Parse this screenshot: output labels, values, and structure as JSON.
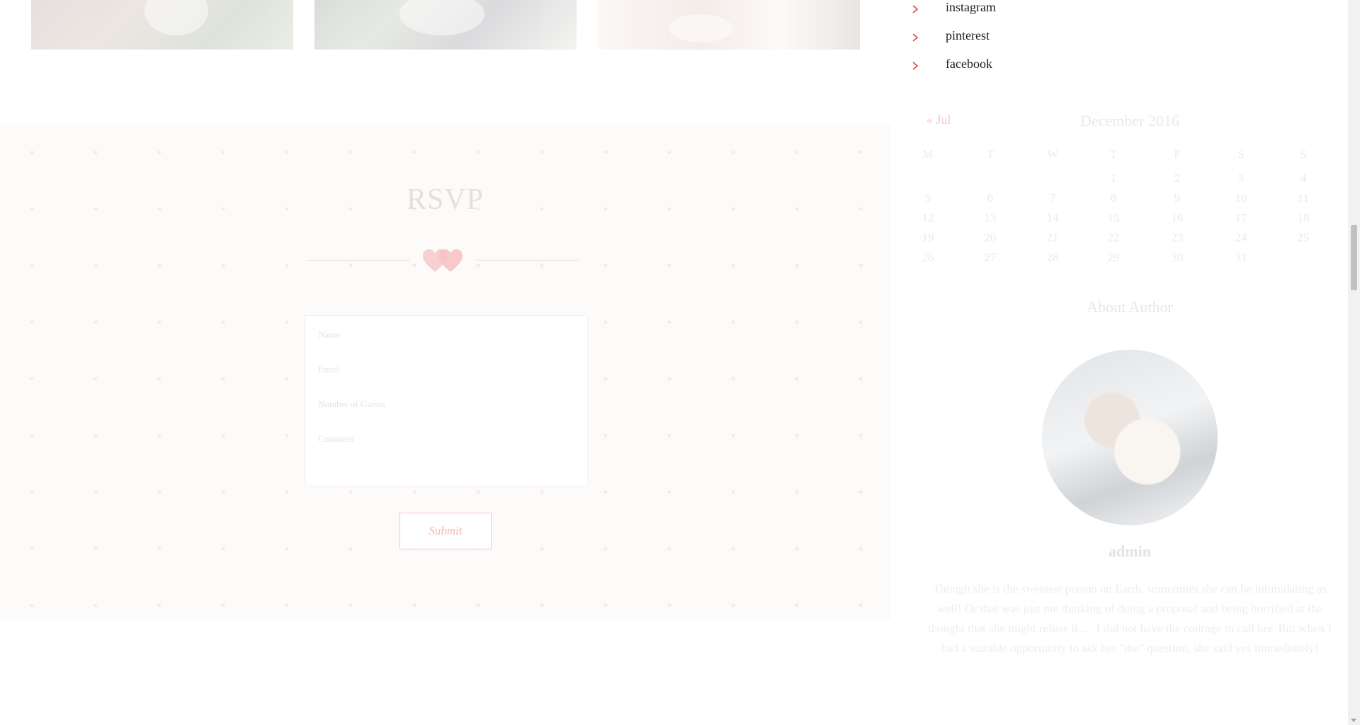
{
  "sidebar": {
    "social_links": [
      {
        "label": "instagram",
        "icon": "chevron-right-icon"
      },
      {
        "label": "pinterest",
        "icon": "chevron-right-icon"
      },
      {
        "label": "facebook",
        "icon": "chevron-right-icon"
      }
    ],
    "calendar": {
      "caption": "December 2016",
      "prev_link": "« Jul",
      "weekdays": [
        "M",
        "T",
        "W",
        "T",
        "F",
        "S",
        "S"
      ],
      "weeks": [
        [
          "",
          "",
          "",
          "1",
          "2",
          "3",
          "4"
        ],
        [
          "5",
          "6",
          "7",
          "8",
          "9",
          "10",
          "11"
        ],
        [
          "12",
          "13",
          "14",
          "15",
          "16",
          "17",
          "18"
        ],
        [
          "19",
          "20",
          "21",
          "22",
          "23",
          "24",
          "25"
        ],
        [
          "26",
          "27",
          "28",
          "29",
          "30",
          "31",
          ""
        ]
      ]
    },
    "about": {
      "title": "About Author",
      "name": "admin",
      "bio": "Though she is the sweetest person on Earth, sometimes she can be intimidating as well! Or that was just me thinking of doing a proposal and being horrified at the thought that she might refuse it … I did not have the courage to call her. But when I had a suitable opportunity to ask her \"the\" question, she said yes immediately!"
    }
  },
  "rsvp": {
    "title": "RSVP",
    "fields": {
      "name_placeholder": "Name",
      "email_placeholder": "Email",
      "guests_placeholder": "Number of Guests",
      "comment_placeholder": "Comment"
    },
    "submit_label": "Submit"
  },
  "colors": {
    "accent": "#e8414a",
    "section_bg": "#fdfafa"
  }
}
